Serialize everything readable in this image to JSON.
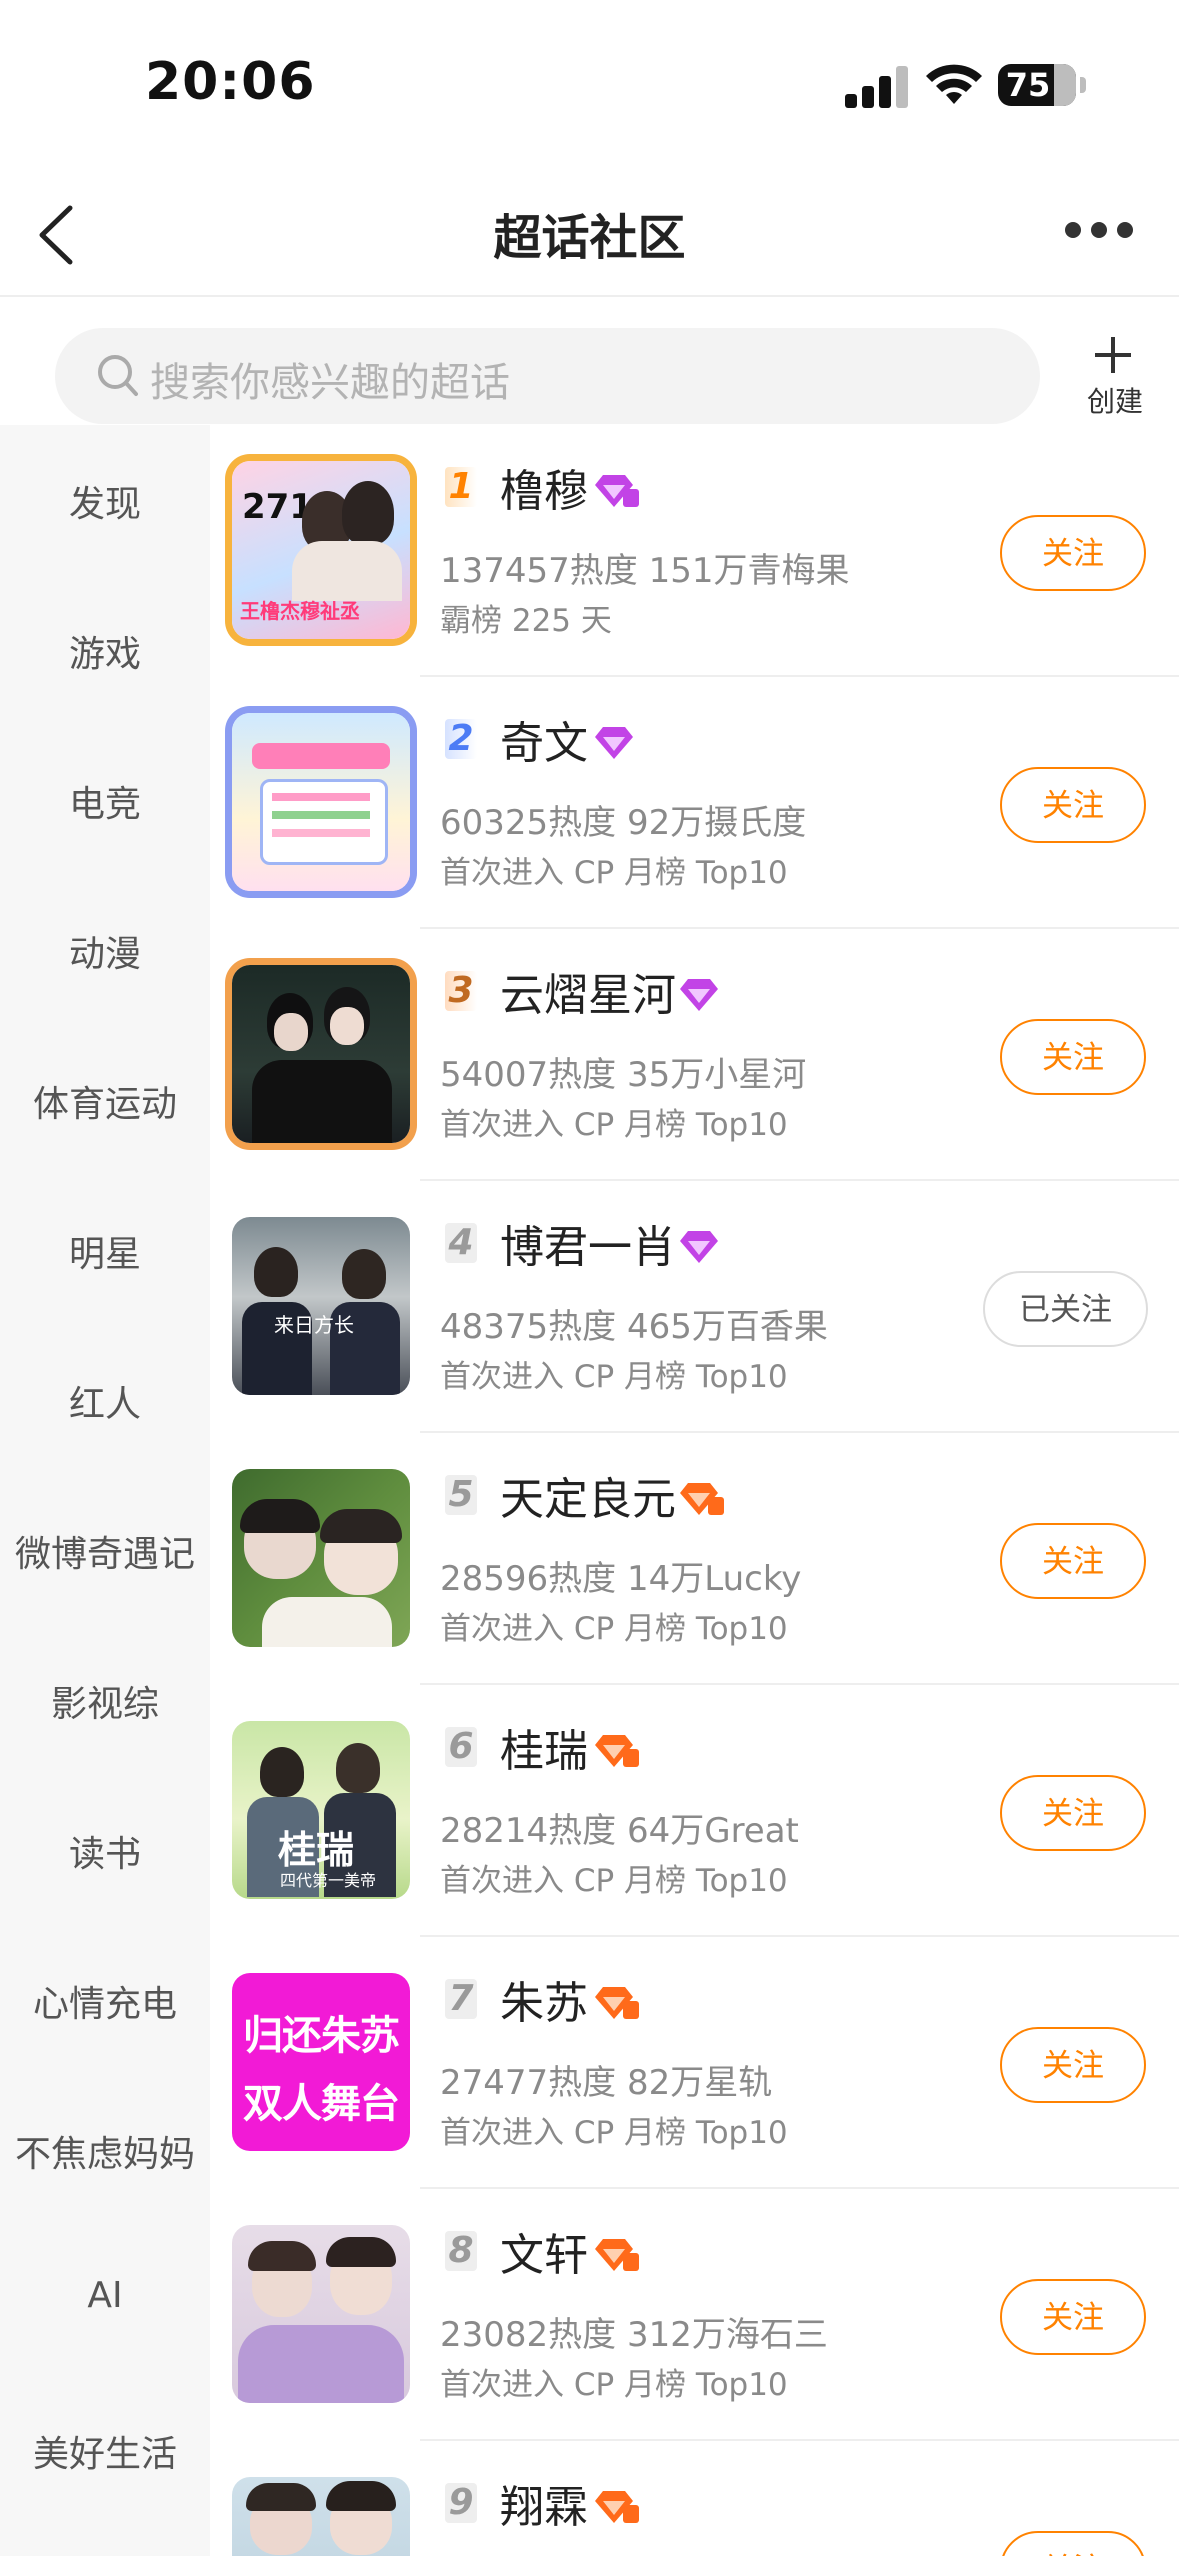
{
  "status_bar": {
    "time": "20:06",
    "battery": "75"
  },
  "nav": {
    "title": "超话社区"
  },
  "search": {
    "placeholder": "搜索你感兴趣的超话"
  },
  "create": {
    "label": "创建"
  },
  "sidebar": {
    "items": [
      "发现",
      "游戏",
      "电竞",
      "动漫",
      "体育运动",
      "明星",
      "红人",
      "微博奇遇记",
      "影视综",
      "读书",
      "心情充电",
      "不焦虑妈妈",
      "AI",
      "美好生活"
    ]
  },
  "list": [
    {
      "rank": "1",
      "name": "橹穆",
      "stats": "137457热度 151万青梅果",
      "sub": "霸榜 225 天",
      "button": "关注",
      "followed": false,
      "badge": "purple",
      "thumb_text": "2711",
      "thumb_sub": "王橹杰穆祉丞"
    },
    {
      "rank": "2",
      "name": "奇文",
      "stats": "60325热度 92万摄氏度",
      "sub": "首次进入 CP 月榜 Top10",
      "button": "关注",
      "followed": false,
      "badge": "purple"
    },
    {
      "rank": "3",
      "name": "云熠星河",
      "stats": "54007热度 35万小星河",
      "sub": "首次进入 CP 月榜 Top10",
      "button": "关注",
      "followed": false,
      "badge": "purple"
    },
    {
      "rank": "4",
      "name": "博君一肖",
      "stats": "48375热度 465万百香果",
      "sub": "首次进入 CP 月榜 Top10",
      "button": "已关注",
      "followed": true,
      "badge": "purple",
      "thumb_text": "来日方长"
    },
    {
      "rank": "5",
      "name": "天定良元",
      "stats": "28596热度 14万Lucky",
      "sub": "首次进入 CP 月榜 Top10",
      "button": "关注",
      "followed": false,
      "badge": "orange"
    },
    {
      "rank": "6",
      "name": "桂瑞",
      "stats": "28214热度 64万Great",
      "sub": "首次进入 CP 月榜 Top10",
      "button": "关注",
      "followed": false,
      "badge": "orange",
      "thumb_text": "桂瑞",
      "thumb_sub": "四代第一美帝"
    },
    {
      "rank": "7",
      "name": "朱苏",
      "stats": "27477热度 82万星轨",
      "sub": "首次进入 CP 月榜 Top10",
      "button": "关注",
      "followed": false,
      "badge": "orange",
      "thumb_text": "归还朱苏",
      "thumb_sub": "双人舞台"
    },
    {
      "rank": "8",
      "name": "文轩",
      "stats": "23082热度 312万海石三",
      "sub": "首次进入 CP 月榜 Top10",
      "button": "关注",
      "followed": false,
      "badge": "orange"
    },
    {
      "rank": "9",
      "name": "翔霖",
      "stats": "",
      "sub": "",
      "button": "关注",
      "followed": false,
      "badge": "orange"
    }
  ],
  "colors": {
    "accent": "#ff8200",
    "purple_badge": "#c243e6",
    "orange_badge": "#ff6a1a"
  }
}
